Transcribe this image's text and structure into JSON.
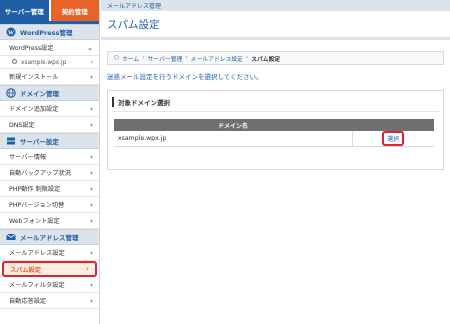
{
  "top_tabs": {
    "server": "サーバー管理",
    "contract": "契約管理"
  },
  "sidebar": {
    "wordpress": {
      "title": "WordPress管理",
      "items": [
        {
          "label": "WordPress設定"
        }
      ],
      "sub": {
        "label": "xsample.wpx.jp"
      },
      "after": [
        {
          "label": "新規インストール"
        }
      ]
    },
    "domain": {
      "title": "ドメイン管理",
      "items": [
        {
          "label": "ドメイン追加設定"
        },
        {
          "label": "DNS設定"
        }
      ]
    },
    "server": {
      "title": "サーバー設定",
      "items": [
        {
          "label": "サーバー情報"
        },
        {
          "label": "自動バックアップ状況"
        },
        {
          "label": "PHP動作 制限設定"
        },
        {
          "label": "PHPバージョン切替"
        },
        {
          "label": "Webフォント設定"
        }
      ]
    },
    "mail": {
      "title": "メールアドレス管理",
      "items": [
        {
          "label": "メールアドレス設定"
        },
        {
          "label": "スパム設定"
        },
        {
          "label": "メールフィルタ設定"
        },
        {
          "label": "自動応答設定"
        }
      ]
    }
  },
  "main": {
    "section_label": "メールアドレス管理",
    "title": "スパム設定",
    "breadcrumb": [
      "ホーム",
      "サーバー管理",
      "メールアドレス設定",
      "スパム設定"
    ],
    "instruction": "迷惑メール設定を行うドメインを選択してください。",
    "panel_title": "対象ドメイン選択",
    "table": {
      "header_domain": "ドメイン名",
      "rows": [
        {
          "domain": "xsample.wpx.jp",
          "action": "選択"
        }
      ]
    }
  },
  "colors": {
    "brand_blue": "#1e5fa6",
    "accent_orange": "#e8632a",
    "highlight_red": "#e0242b"
  }
}
